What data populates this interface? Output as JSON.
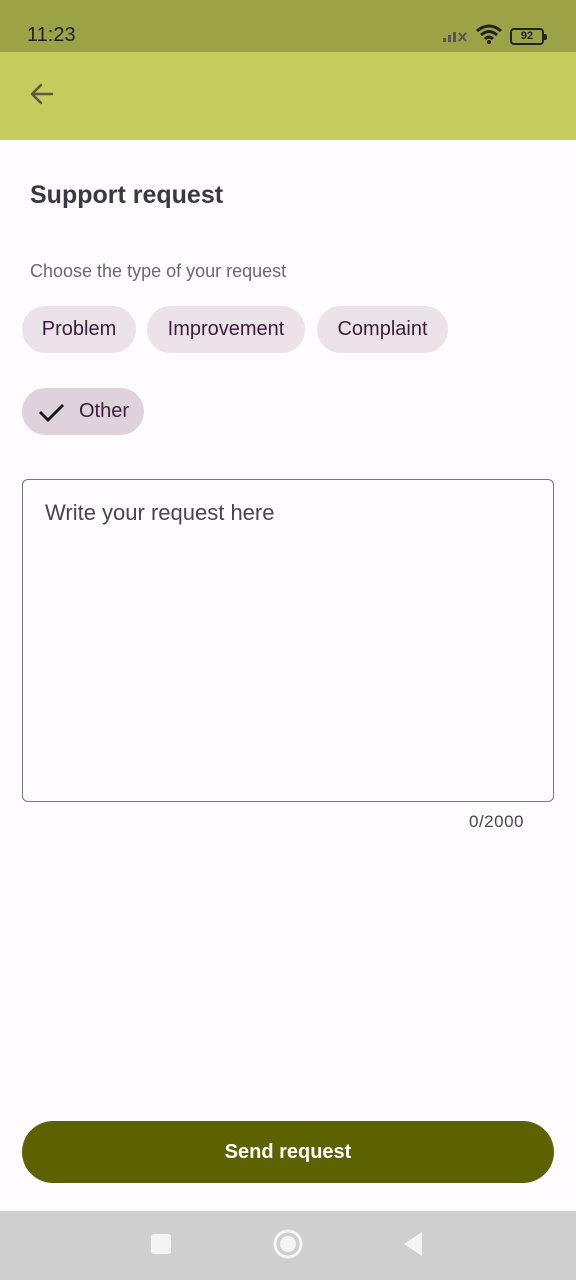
{
  "status_bar": {
    "time": "11:23",
    "battery_level": "92",
    "icons": [
      "signal-icon",
      "wifi-icon",
      "battery-icon"
    ]
  },
  "app_bar": {
    "back_icon": "arrow-back-icon",
    "background_color": "#c4cd5e"
  },
  "page": {
    "title": "Support request",
    "type_label": "Choose the type of your request"
  },
  "chips": [
    {
      "label": "Problem",
      "selected": false
    },
    {
      "label": "Improvement",
      "selected": false
    },
    {
      "label": "Complaint",
      "selected": false
    },
    {
      "label": "Other",
      "selected": true
    }
  ],
  "request_field": {
    "placeholder": "Write your request here",
    "value": "",
    "counter": "0/2000"
  },
  "send_button": {
    "label": "Send request",
    "color": "#5c6200"
  },
  "nav_bar": {
    "buttons": [
      "recents-icon",
      "home-icon",
      "back-triangle-icon"
    ]
  }
}
